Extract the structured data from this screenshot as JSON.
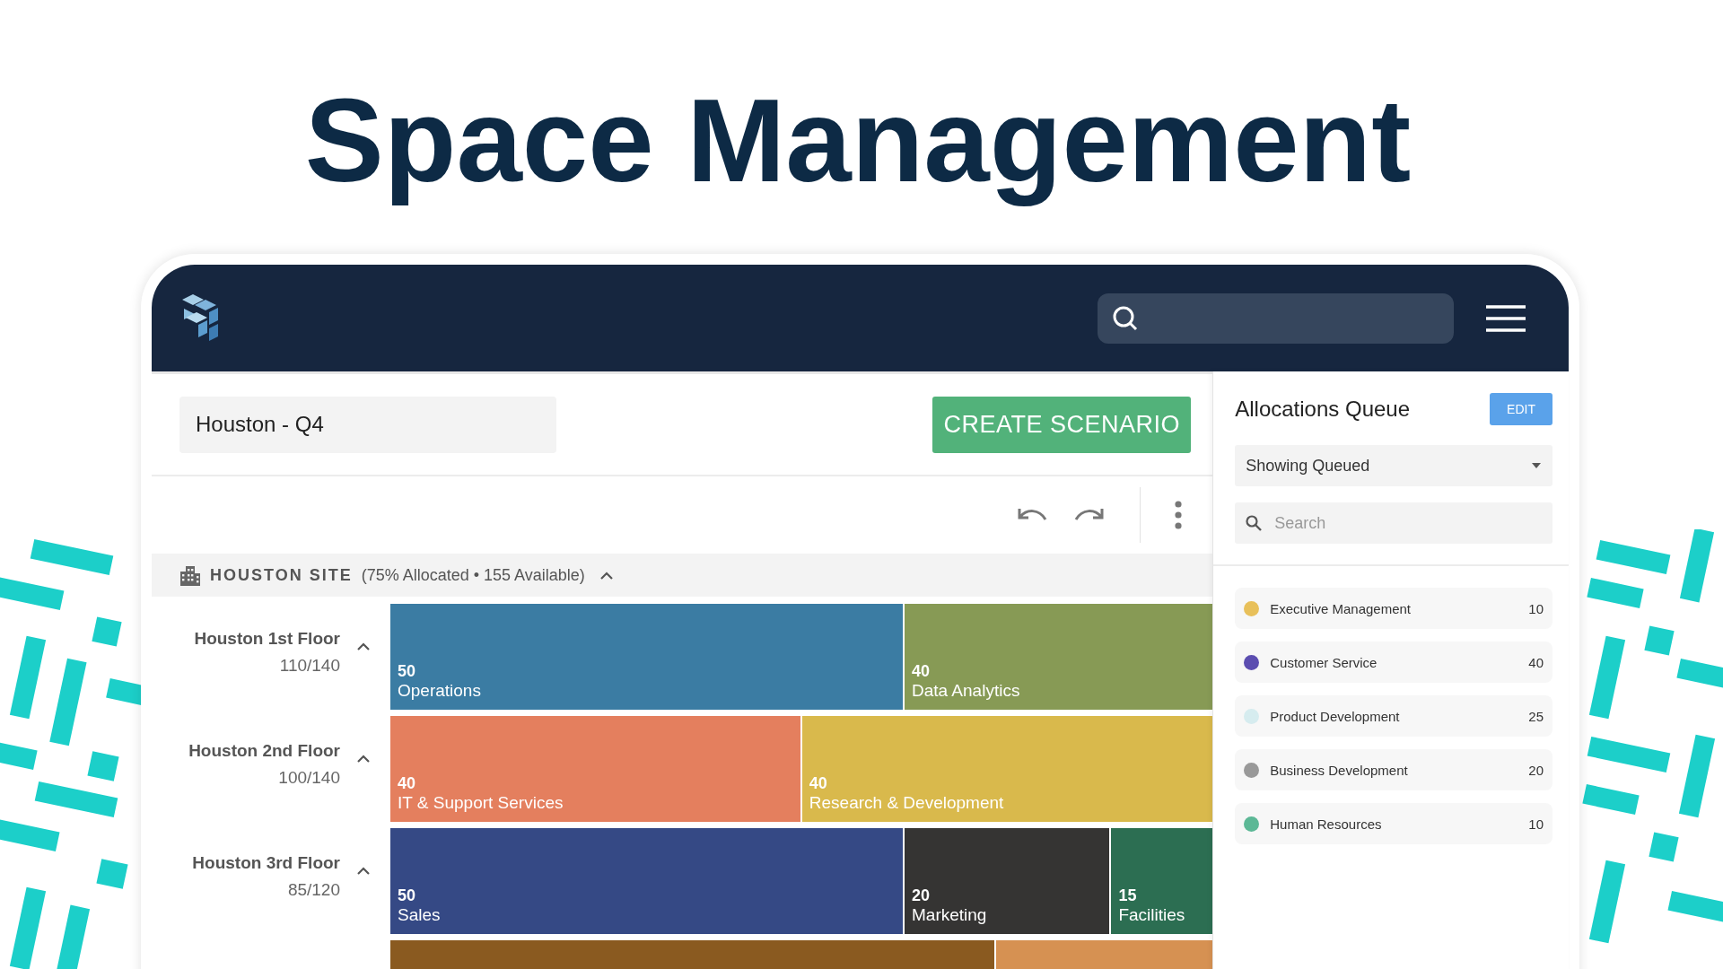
{
  "heading": "Space Management",
  "scenario": {
    "value": "Houston - Q4"
  },
  "create_button": "CREATE SCENARIO",
  "site": {
    "name": "HOUSTON SITE",
    "summary": "(75% Allocated • 155 Available)",
    "expanded": true
  },
  "floors": [
    {
      "name": "Houston 1st Floor",
      "count": "110/140",
      "expanded": true,
      "segments": [
        {
          "value": "50",
          "name": "Operations",
          "color": "#3b7ca3"
        },
        {
          "value": "40",
          "name": "Data Analytics",
          "color": "#879a55"
        }
      ]
    },
    {
      "name": "Houston 2nd Floor",
      "count": "100/140",
      "expanded": true,
      "segments": [
        {
          "value": "40",
          "name": "IT & Support Services",
          "color": "#e47f5e"
        },
        {
          "value": "40",
          "name": "Research & Development",
          "color": "#d9b94c"
        }
      ]
    },
    {
      "name": "Houston 3rd Floor",
      "count": "85/120",
      "expanded": true,
      "segments": [
        {
          "value": "50",
          "name": "Sales",
          "color": "#354985"
        },
        {
          "value": "20",
          "name": "Marketing",
          "color": "#353433"
        },
        {
          "value": "15",
          "name": "Facilities",
          "color": "#2c6e52"
        }
      ]
    },
    {
      "segments": [
        {
          "color": "#8a5a20"
        },
        {
          "color": "#d69152"
        }
      ]
    }
  ],
  "queue": {
    "title": "Allocations Queue",
    "edit_button": "EDIT",
    "filter": "Showing Queued",
    "search": {
      "placeholder": "Search"
    },
    "items": [
      {
        "name": "Executive Management",
        "count": "10",
        "color": "#e8c05a"
      },
      {
        "name": "Customer Service",
        "count": "40",
        "color": "#5b4db0"
      },
      {
        "name": "Product Development",
        "count": "25",
        "color": "#d6ecef"
      },
      {
        "name": "Business Development",
        "count": "20",
        "color": "#999999"
      },
      {
        "name": "Human Resources",
        "count": "10",
        "color": "#5cb896"
      }
    ]
  }
}
